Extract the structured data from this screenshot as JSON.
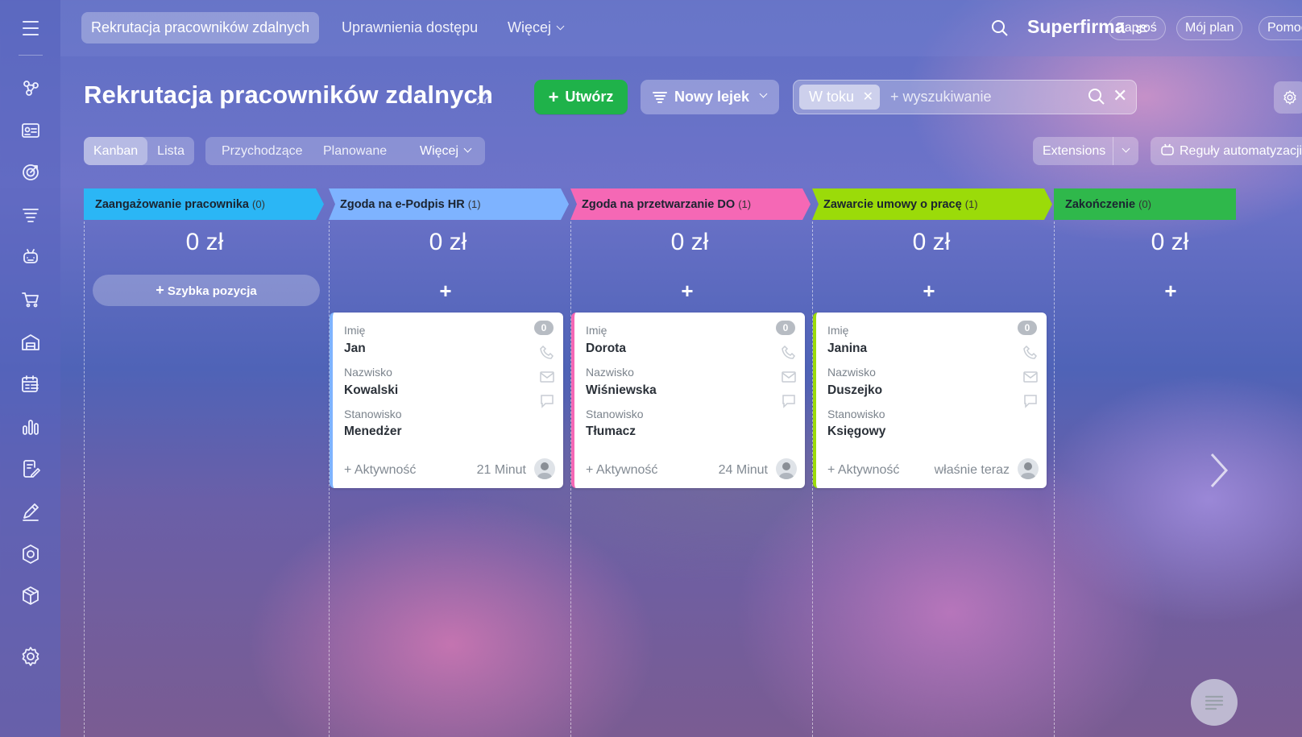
{
  "topbar": {
    "tabs": [
      "Rekrutacja pracowników zdalnych",
      "Uprawnienia dostępu",
      "Więcej"
    ],
    "brand": "Superfirma",
    "buttons": [
      "Zaproś",
      "Mój plan",
      "Pomoc"
    ]
  },
  "header": {
    "title": "Rekrutacja pracowników zdalnych",
    "create_label": "Utwórz",
    "funnel_label": "Nowy lejek",
    "filter_chip": "W toku",
    "search_placeholder": "+ wyszukiwanie"
  },
  "views": {
    "modes": [
      "Kanban",
      "Lista"
    ],
    "filters": [
      "Przychodzące",
      "Planowane",
      "Więcej"
    ],
    "extensions_label": "Extensions",
    "rules_label": "Reguły automatyzacji"
  },
  "columns": [
    {
      "title": "Zaangażowanie pracownika",
      "count": "(0)",
      "sum": "0 zł",
      "color": "#2bb6f5"
    },
    {
      "title": "Zgoda na e-Podpis HR",
      "count": "(1)",
      "sum": "0 zł",
      "color": "#7eb3ff"
    },
    {
      "title": "Zgoda na przetwarzanie DO",
      "count": "(1)",
      "sum": "0 zł",
      "color": "#f568b5"
    },
    {
      "title": "Zawarcie umowy o pracę",
      "count": "(1)",
      "sum": "0 zł",
      "color": "#9bdb09"
    },
    {
      "title": "Zakończenie",
      "count": "(0)",
      "sum": "0 zł",
      "color": "#2fb84b"
    }
  ],
  "quick_add_label": "Szybka pozycja",
  "card_labels": {
    "first": "Imię",
    "last": "Nazwisko",
    "position": "Stanowisko",
    "activity": "+ Aktywność"
  },
  "cards": [
    {
      "badge": "0",
      "first": "Jan",
      "last": "Kowalski",
      "position": "Menedżer",
      "time": "21 Minut"
    },
    {
      "badge": "0",
      "first": "Dorota",
      "last": "Wiśniewska",
      "position": "Tłumacz",
      "time": "24 Minut"
    },
    {
      "badge": "0",
      "first": "Janina",
      "last": "Duszejko",
      "position": "Księgowy",
      "time": "właśnie teraz"
    }
  ]
}
